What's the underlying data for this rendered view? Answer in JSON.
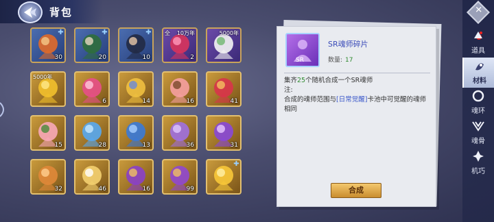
{
  "header": {
    "title": "背包"
  },
  "items": [
    {
      "name": "orange-hair-warrior",
      "quality": "blue",
      "count": "30",
      "plus": true
    },
    {
      "name": "green-hair-warrior",
      "quality": "blue",
      "count": "20",
      "plus": true
    },
    {
      "name": "dark-hair-warrior",
      "quality": "blue",
      "count": "10",
      "plus": true
    },
    {
      "name": "red-flower",
      "quality": "purple",
      "count": "2",
      "tag": "全",
      "tag_r": "10万年"
    },
    {
      "name": "white-lily",
      "quality": "purple",
      "count": "",
      "tag_r": "5000年"
    },
    {
      "name": "chrysanthemum",
      "quality": "gold",
      "count": "",
      "tag": "5000年"
    },
    {
      "name": "gift-box",
      "quality": "gold",
      "count": "6"
    },
    {
      "name": "golden-ring",
      "quality": "gold",
      "count": "14"
    },
    {
      "name": "peach-blossom-branch",
      "quality": "gold",
      "count": "16"
    },
    {
      "name": "red-gem-ring",
      "quality": "gold",
      "count": "41"
    },
    {
      "name": "pink-flower",
      "quality": "gold",
      "count": "15"
    },
    {
      "name": "blue-crystal-large",
      "quality": "gold",
      "count": "28"
    },
    {
      "name": "blue-crystal-small",
      "quality": "gold",
      "count": "13"
    },
    {
      "name": "purple-flower",
      "quality": "gold",
      "count": "36"
    },
    {
      "name": "purple-crystal",
      "quality": "gold",
      "count": "31"
    },
    {
      "name": "orange-coins",
      "quality": "gold",
      "count": "32"
    },
    {
      "name": "golden-bow",
      "quality": "gold",
      "count": "46"
    },
    {
      "name": "purple-scroll-a",
      "quality": "gold",
      "count": "16"
    },
    {
      "name": "purple-scroll-b",
      "quality": "gold",
      "count": "99"
    },
    {
      "name": "gold-fragment",
      "quality": "gold",
      "count": "",
      "plus": true
    }
  ],
  "detail": {
    "name": "SR魂师碎片",
    "qty_label": "数量:",
    "qty_value": "17",
    "desc_prefix": "集齐",
    "desc_num": "25",
    "desc_suffix": "个随机合成一个SR魂师",
    "note_label": "注:",
    "note_text1": "合成的魂师范围与",
    "note_link": "[日常觉醒]",
    "note_text2": "卡池中可觉醒的魂师相同",
    "compose_label": "合成"
  },
  "nav": {
    "items": [
      {
        "label": "道具",
        "icon": "prop-icon"
      },
      {
        "label": "材料",
        "icon": "material-icon"
      },
      {
        "label": "魂环",
        "icon": "soul-ring-icon"
      },
      {
        "label": "魂骨",
        "icon": "soul-bone-icon"
      },
      {
        "label": "机巧",
        "icon": "gadget-icon"
      }
    ],
    "active_index": 1
  },
  "colors": {
    "accent_gold": "#c9a35a",
    "title_blue": "#3a4ab8",
    "green": "#2e8a2e"
  }
}
